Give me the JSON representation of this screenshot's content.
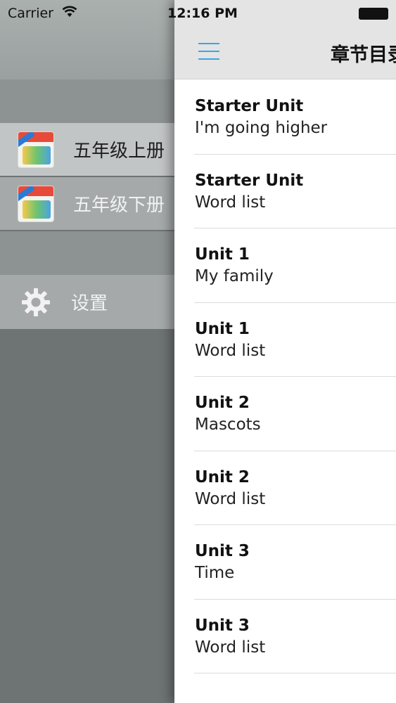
{
  "status_bar": {
    "carrier": "Carrier",
    "time": "12:16 PM"
  },
  "drawer": {
    "books": [
      {
        "label": "五年级上册",
        "icon": "book-cover-icon"
      },
      {
        "label": "五年级下册",
        "icon": "book-cover-icon"
      }
    ],
    "settings": {
      "label": "设置",
      "icon": "gear-icon"
    }
  },
  "navbar": {
    "title": "章节目录",
    "menu_icon": "hamburger-menu-icon",
    "accent_color": "#3aa5e6"
  },
  "chapters": [
    {
      "unit": "Starter Unit",
      "title": "I'm going higher"
    },
    {
      "unit": "Starter Unit",
      "title": "Word list"
    },
    {
      "unit": "Unit 1",
      "title": "My family"
    },
    {
      "unit": "Unit 1",
      "title": "Word list"
    },
    {
      "unit": "Unit 2",
      "title": "Mascots"
    },
    {
      "unit": "Unit 2",
      "title": "Word list"
    },
    {
      "unit": "Unit 3",
      "title": "Time"
    },
    {
      "unit": "Unit 3",
      "title": "Word list"
    }
  ]
}
